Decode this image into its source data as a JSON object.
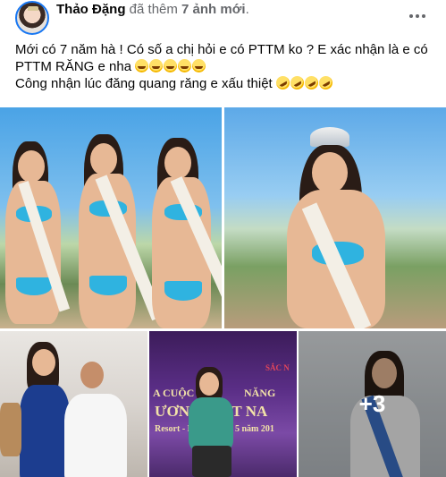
{
  "post": {
    "author": "Thảo Đặng",
    "action_prefix": "đã thêm",
    "action_count": "7 ảnh mới",
    "action_suffix": ".",
    "text_line1": "Mới có 7 năm hà  ! Có số a chị hỏi e có PTTM ko ? E xác nhận là e có",
    "text_line2_prefix": "PTTM RĂNG e nha",
    "text_line3_prefix": "Công nhận lúc đăng quang răng e xấu thiệt",
    "emoji_line2": [
      "grinning-face",
      "grinning-face",
      "grinning-face",
      "grinning-face",
      "grinning-face"
    ],
    "emoji_line3": [
      "rolling-on-floor-laughing",
      "rolling-on-floor-laughing",
      "rolling-on-floor-laughing",
      "rolling-on-floor-laughing"
    ]
  },
  "photos": {
    "photo4_banner_1": "A CUỘC",
    "photo4_banner_2": "NĂNG",
    "photo4_banner_3": "ƯƠNG VIỆT NA",
    "photo4_banner_4": "Resort - Ngày",
    "photo4_banner_5": "5 năm 201",
    "photo4_banner_6": "SẮC N",
    "more_count": "+3"
  },
  "colors": {
    "avatar_ring": "#1877f2",
    "secondary_text": "#65676b",
    "primary_text": "#050505"
  }
}
